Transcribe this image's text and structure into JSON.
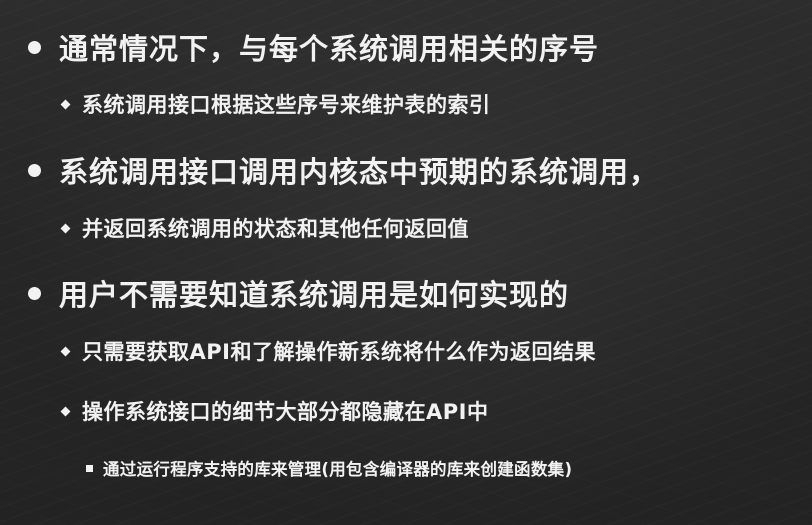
{
  "slide": {
    "bullets": [
      {
        "text": "通常情况下，与每个系统调用相关的序号",
        "sub": [
          {
            "text": "系统调用接口根据这些序号来维护表的索引"
          }
        ]
      },
      {
        "text": "系统调用接口调用内核态中预期的系统调用，",
        "sub": [
          {
            "text": "并返回系统调用的状态和其他任何返回值"
          }
        ]
      },
      {
        "text": "用户不需要知道系统调用是如何实现的",
        "sub": [
          {
            "text": "只需要获取API和了解操作新系统将什么作为返回结果"
          },
          {
            "text": "操作系统接口的细节大部分都隐藏在API中",
            "sub": [
              {
                "text": "通过运行程序支持的库来管理(用包含编译器的库来创建函数集)"
              }
            ]
          }
        ]
      }
    ]
  }
}
